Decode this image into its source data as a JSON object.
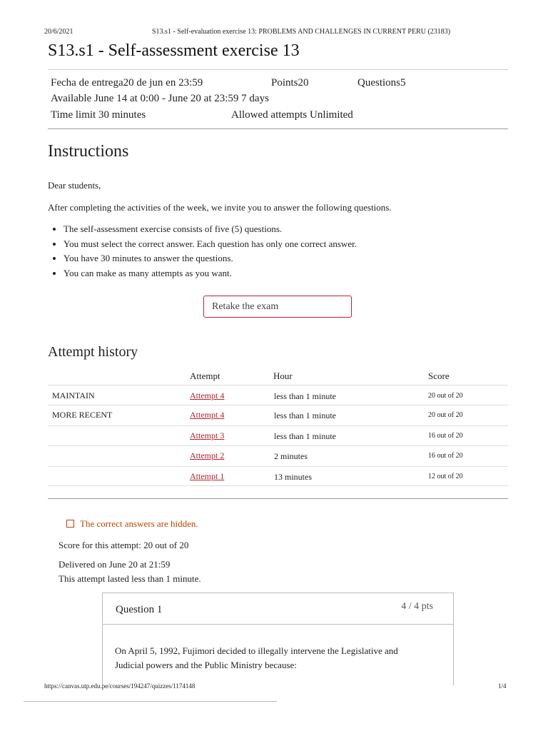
{
  "print_header": {
    "date": "20/6/2021",
    "title": "S13.s1 - Self-evaluation exercise 13: PROBLEMS AND CHALLENGES IN CURRENT PERU (23183)"
  },
  "quiz": {
    "title": "S13.s1 - Self-assessment exercise 13",
    "due": "Fecha de entrega20 de jun en 23:59",
    "points": "Points20",
    "questions": "Questions5",
    "available": "Available June 14 at 0:00 - June 20 at 23:59 7 days",
    "time_limit": "Time limit 30 minutes",
    "attempts_allowed": "Allowed attempts Unlimited"
  },
  "instructions": {
    "heading": "Instructions",
    "greeting": "Dear students,",
    "intro": "After completing the activities of the week, we invite you to answer the following questions.",
    "bullets": [
      "The self-assessment exercise consists of five (5) questions.",
      "You must select the correct answer. Each question has only one correct answer.",
      "You have 30 minutes to answer the questions.",
      "You can make as many attempts as you want."
    ]
  },
  "retake_button": "Retake the exam",
  "history": {
    "heading": "Attempt history",
    "columns": [
      "Attempt",
      "Hour",
      "Score"
    ],
    "rows": [
      {
        "label": "MAINTAIN",
        "attempt": "Attempt 4",
        "hour": "less than 1 minute",
        "score": "20 out of 20"
      },
      {
        "label": "MORE RECENT",
        "attempt": "Attempt 4",
        "hour": "less than 1 minute",
        "score": "20 out of 20"
      },
      {
        "label": "",
        "attempt": "Attempt 3",
        "hour": "less than 1 minute",
        "score": "16 out of 20"
      },
      {
        "label": "",
        "attempt": "Attempt 2",
        "hour": "2 minutes",
        "score": "16 out of 20"
      },
      {
        "label": "",
        "attempt": "Attempt 1",
        "hour": "13 minutes",
        "score": "12 out of 20"
      }
    ]
  },
  "result": {
    "hidden_notice": "The correct answers are hidden.",
    "score": "Score for this attempt: 20 out of 20",
    "delivered": "Delivered on June 20 at 21:59",
    "duration": "This attempt lasted less than 1 minute."
  },
  "question1": {
    "title": "Question 1",
    "points": "4 / 4 pts",
    "text": "On April 5, 1992, Fujimori decided to illegally intervene the Legislative and Judicial powers and the Public Ministry because:"
  },
  "print_footer": {
    "url": "https://canvas.utp.edu.pe/courses/194247/quizzes/1174148",
    "page": "1/4"
  },
  "colors": {
    "link": "#b2232d",
    "warning": "#c04400"
  }
}
